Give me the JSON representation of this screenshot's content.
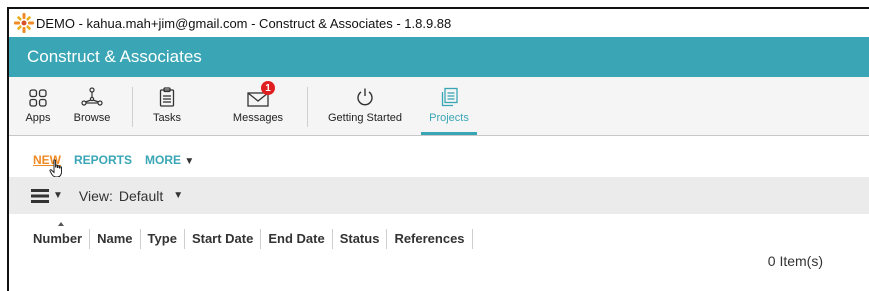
{
  "window": {
    "title": "DEMO - kahua.mah+jim@gmail.com - Construct & Associates - 1.8.9.88",
    "logo_icon": "kahua-star-logo-icon"
  },
  "brand": {
    "name": "Construct & Associates",
    "color": "#3aa6b5"
  },
  "toolbar": {
    "apps": "Apps",
    "browse": "Browse",
    "tasks": "Tasks",
    "messages": "Messages",
    "messages_badge": "1",
    "getting_started": "Getting Started",
    "projects": "Projects",
    "active": "Projects"
  },
  "actions": {
    "new": "NEW",
    "reports": "REPORTS",
    "more": "MORE"
  },
  "viewbar": {
    "view_label": "View:",
    "view_value": "Default"
  },
  "columns": [
    "Number",
    "Name",
    "Type",
    "Start Date",
    "End Date",
    "Status",
    "References"
  ],
  "list": {
    "item_count": "0 Item(s)"
  },
  "colors": {
    "accent": "#3aa6b5",
    "new_link": "#f08a24",
    "badge": "#e02020"
  }
}
